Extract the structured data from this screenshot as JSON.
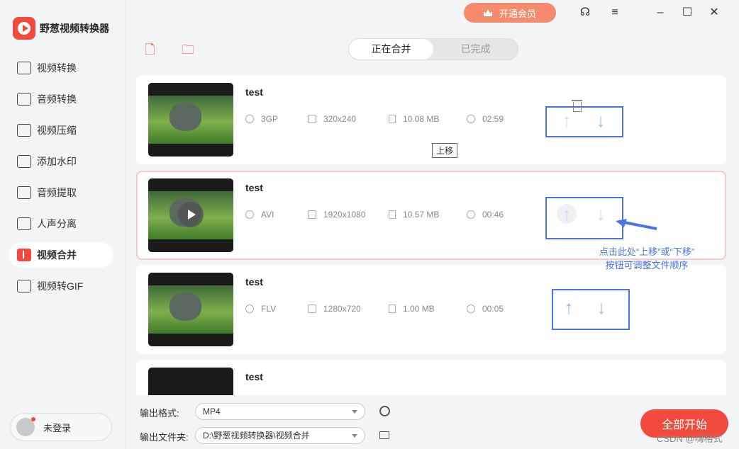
{
  "app": {
    "title": "野葱视频转换器"
  },
  "sidebar": {
    "items": [
      {
        "label": "视频转换",
        "icon": "video-convert-icon"
      },
      {
        "label": "音频转换",
        "icon": "audio-convert-icon"
      },
      {
        "label": "视频压缩",
        "icon": "video-compress-icon"
      },
      {
        "label": "添加水印",
        "icon": "watermark-icon"
      },
      {
        "label": "音频提取",
        "icon": "audio-extract-icon"
      },
      {
        "label": "人声分离",
        "icon": "vocal-separate-icon"
      },
      {
        "label": "视频合并",
        "icon": "video-merge-icon",
        "active": true
      },
      {
        "label": "视频转GIF",
        "icon": "gif-icon"
      }
    ],
    "login_label": "未登录"
  },
  "header": {
    "vip_label": "开通会员"
  },
  "tabs": [
    {
      "label": "正在合并",
      "active": true
    },
    {
      "label": "已完成"
    }
  ],
  "files": [
    {
      "name": "test",
      "format": "3GP",
      "resolution": "320x240",
      "size": "10.08 MB",
      "duration": "02:59"
    },
    {
      "name": "test",
      "format": "AVI",
      "resolution": "1920x1080",
      "size": "10.57 MB",
      "duration": "00:46",
      "selected": true
    },
    {
      "name": "test",
      "format": "FLV",
      "resolution": "1280x720",
      "size": "1.00 MB",
      "duration": "00:05"
    },
    {
      "name": "test"
    }
  ],
  "tooltip": "上移",
  "annotation": {
    "line1": "点击此处“上移”或“下移”",
    "line2": "按钮可调整文件顺序"
  },
  "bottom": {
    "format_label": "输出格式:",
    "format_value": "MP4",
    "folder_label": "输出文件夹:",
    "folder_value": "D:\\野葱视频转换器\\视频合并",
    "start_label": "全部开始"
  },
  "watermark": "CSDN @嗨格式",
  "colors": {
    "accent": "#f24b3e",
    "annotation": "#4b74e6"
  }
}
